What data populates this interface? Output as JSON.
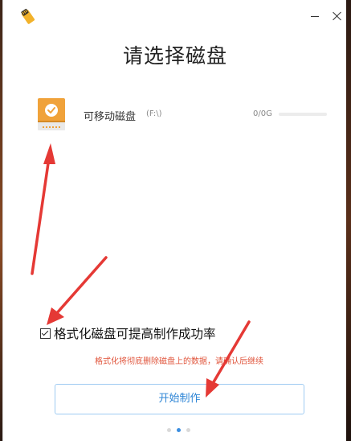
{
  "window": {
    "title": "请选择磁盘",
    "minimize_icon": "minimize-icon",
    "close_icon": "close-icon"
  },
  "disk": {
    "name": "可移动磁盘",
    "letter": "(F:\\)",
    "size": "0/0G",
    "usage_fraction": 0.0,
    "icon": "removable-disk-icon"
  },
  "format_option": {
    "checked": true,
    "label": "格式化磁盘可提高制作成功率"
  },
  "warning": "格式化将彻底删除磁盘上的数据，请确认后继续",
  "start_button": "开始制作",
  "pager": {
    "count": 3,
    "active": 1
  },
  "colors": {
    "accent": "#2f86d6",
    "warning": "#e0543b",
    "disk_orange": "#f0a23a",
    "annotation_red": "#e53935"
  }
}
